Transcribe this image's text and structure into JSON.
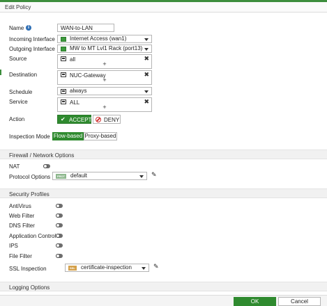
{
  "header": {
    "title": "Edit Policy"
  },
  "form": {
    "name_label": "Name",
    "name_value": "WAN-to-LAN",
    "incoming_label": "Incoming Interface",
    "incoming_value": "Internet Access (wan1)",
    "outgoing_label": "Outgoing Interface",
    "outgoing_value": "MW to MT Lvl1 Rack (port13)",
    "source_label": "Source",
    "source_value": "all",
    "destination_label": "Destination",
    "destination_value": "NUC-Gateway",
    "schedule_label": "Schedule",
    "schedule_value": "always",
    "service_label": "Service",
    "service_value": "ALL",
    "action_label": "Action",
    "accept_label": "ACCEPT",
    "deny_label": "DENY",
    "inspection_label": "Inspection Mode",
    "flow_label": "Flow-based",
    "proxy_label": "Proxy-based",
    "add_symbol": "+",
    "remove_symbol": "✖"
  },
  "firewall": {
    "title": "Firewall / Network Options",
    "nat_label": "NAT",
    "protocol_label": "Protocol Options",
    "protocol_tag": "PROT",
    "protocol_value": "default"
  },
  "security": {
    "title": "Security Profiles",
    "antivirus_label": "AntiVirus",
    "webfilter_label": "Web Filter",
    "dnsfilter_label": "DNS Filter",
    "appcontrol_label": "Application Control",
    "ips_label": "IPS",
    "filefilter_label": "File Filter",
    "ssl_label": "SSL Inspection",
    "ssl_tag": "SSL",
    "ssl_value": "certificate-inspection"
  },
  "logging": {
    "title": "Logging Options"
  },
  "footer": {
    "ok_label": "OK",
    "cancel_label": "Cancel"
  },
  "colors": {
    "accent": "#2f8a2f",
    "info": "#2f6fb5",
    "deny": "#d03030"
  }
}
